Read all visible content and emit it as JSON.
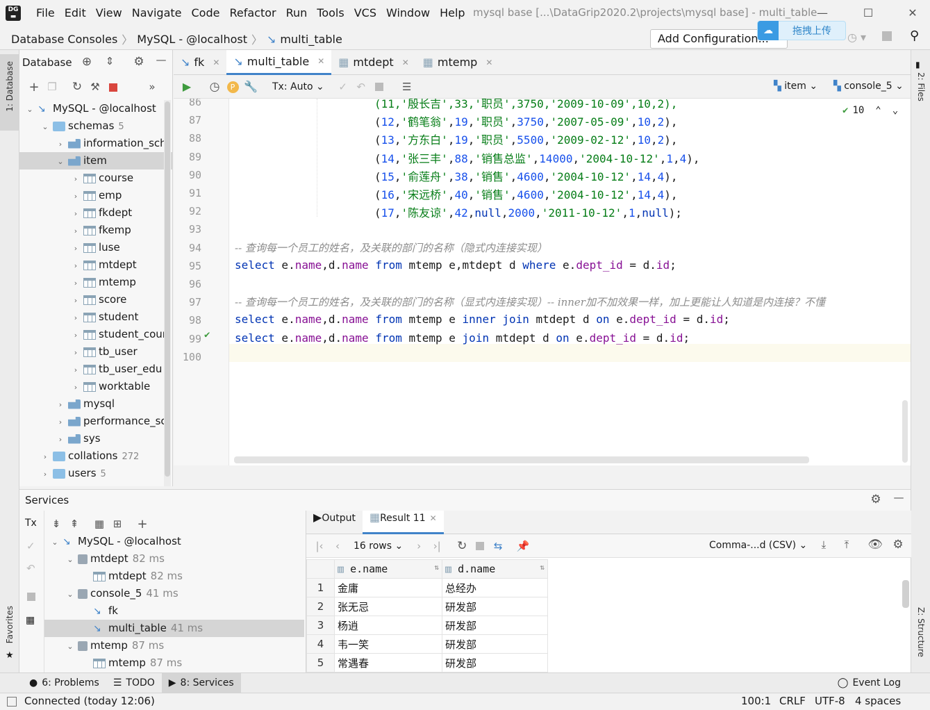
{
  "window": {
    "title": "mysql base [...\\DataGrip2020.2\\projects\\mysql base] - multi_table",
    "menu": [
      "File",
      "Edit",
      "View",
      "Navigate",
      "Code",
      "Refactor",
      "Run",
      "Tools",
      "VCS",
      "Window",
      "Help"
    ]
  },
  "breadcrumb": [
    "Database Consoles",
    "MySQL - @localhost",
    "multi_table"
  ],
  "toolbar": {
    "add_configuration": "Add Configuration...",
    "upload_label": "拖拽上传"
  },
  "stripes": {
    "database": "1: Database",
    "favorites": "Favorites",
    "files": "2: Files",
    "structure": "Z: Structure"
  },
  "db_panel": {
    "title": "Database",
    "tree": [
      {
        "label": "MySQL - @localhost",
        "icon": "mysql-connection-icon",
        "indent": 0,
        "open": true
      },
      {
        "label": "schemas",
        "count": "5",
        "icon": "folder-icon",
        "indent": 1,
        "open": true
      },
      {
        "label": "information_sch",
        "icon": "schema-icon",
        "indent": 2,
        "open": false
      },
      {
        "label": "item",
        "icon": "schema-icon",
        "indent": 2,
        "open": true,
        "selected": true
      },
      {
        "label": "course",
        "icon": "table-icon",
        "indent": 3
      },
      {
        "label": "emp",
        "icon": "table-icon",
        "indent": 3
      },
      {
        "label": "fkdept",
        "icon": "table-icon",
        "indent": 3
      },
      {
        "label": "fkemp",
        "icon": "table-icon",
        "indent": 3
      },
      {
        "label": "luse",
        "icon": "table-icon",
        "indent": 3
      },
      {
        "label": "mtdept",
        "icon": "table-icon",
        "indent": 3
      },
      {
        "label": "mtemp",
        "icon": "table-icon",
        "indent": 3
      },
      {
        "label": "score",
        "icon": "table-icon",
        "indent": 3
      },
      {
        "label": "student",
        "icon": "table-icon",
        "indent": 3
      },
      {
        "label": "student_cour",
        "icon": "table-icon",
        "indent": 3
      },
      {
        "label": "tb_user",
        "icon": "table-icon",
        "indent": 3
      },
      {
        "label": "tb_user_edu",
        "icon": "table-icon",
        "indent": 3
      },
      {
        "label": "worktable",
        "icon": "table-icon",
        "indent": 3
      },
      {
        "label": "mysql",
        "icon": "schema-icon",
        "indent": 2,
        "open": false
      },
      {
        "label": "performance_sc",
        "icon": "schema-icon",
        "indent": 2,
        "open": false
      },
      {
        "label": "sys",
        "icon": "schema-icon",
        "indent": 2,
        "open": false
      },
      {
        "label": "collations",
        "count": "272",
        "icon": "folder-icon",
        "indent": 1,
        "open": false
      },
      {
        "label": "users",
        "count": "5",
        "icon": "folder-icon",
        "indent": 1,
        "open": false
      }
    ]
  },
  "editor": {
    "tabs": [
      {
        "label": "fk",
        "icon": "console-icon",
        "active": false
      },
      {
        "label": "multi_table",
        "icon": "console-icon",
        "active": true
      },
      {
        "label": "mtdept",
        "icon": "table-icon",
        "active": false
      },
      {
        "label": "mtemp",
        "icon": "table-icon",
        "active": false
      }
    ],
    "tx_mode": "Tx: Auto",
    "schema_selector": "item",
    "console_selector": "console_5",
    "inspection_count": "10",
    "lines": [
      {
        "n": "86",
        "html": "<span class=\"str\">(11,'殷长吉',33,'职员',3750,'2009-10-09',10,2),</span>"
      },
      {
        "n": "87",
        "html": "(<span class=\"num\">12</span>,<span class=\"str\">'鹤笔翁'</span>,<span class=\"num\">19</span>,<span class=\"str\">'职员'</span>,<span class=\"num\">3750</span>,<span class=\"str\">'2007-05-09'</span>,<span class=\"num\">10</span>,<span class=\"num\">2</span>),"
      },
      {
        "n": "88",
        "html": "(<span class=\"num\">13</span>,<span class=\"str\">'方东白'</span>,<span class=\"num\">19</span>,<span class=\"str\">'职员'</span>,<span class=\"num\">5500</span>,<span class=\"str\">'2009-02-12'</span>,<span class=\"num\">10</span>,<span class=\"num\">2</span>),"
      },
      {
        "n": "89",
        "html": "(<span class=\"num\">14</span>,<span class=\"str\">'张三丰'</span>,<span class=\"num\">88</span>,<span class=\"str\">'销售总监'</span>,<span class=\"num\">14000</span>,<span class=\"str\">'2004-10-12'</span>,<span class=\"num\">1</span>,<span class=\"num\">4</span>),"
      },
      {
        "n": "90",
        "html": "(<span class=\"num\">15</span>,<span class=\"str\">'俞莲舟'</span>,<span class=\"num\">38</span>,<span class=\"str\">'销售'</span>,<span class=\"num\">4600</span>,<span class=\"str\">'2004-10-12'</span>,<span class=\"num\">14</span>,<span class=\"num\">4</span>),"
      },
      {
        "n": "91",
        "html": "(<span class=\"num\">16</span>,<span class=\"str\">'宋远桥'</span>,<span class=\"num\">40</span>,<span class=\"str\">'销售'</span>,<span class=\"num\">4600</span>,<span class=\"str\">'2004-10-12'</span>,<span class=\"num\">14</span>,<span class=\"num\">4</span>),"
      },
      {
        "n": "92",
        "html": "(<span class=\"num\">17</span>,<span class=\"str\">'陈友谅'</span>,<span class=\"num\">42</span>,<span class=\"kw\">null</span>,<span class=\"num\">2000</span>,<span class=\"str\">'2011-10-12'</span>,<span class=\"num\">1</span>,<span class=\"kw\">null</span>);"
      },
      {
        "n": "93",
        "html": ""
      },
      {
        "n": "94",
        "html": "<span class=\"cm\">-- 查询每一个员工的姓名，及关联的部门的名称（隐式内连接实现）</span>"
      },
      {
        "n": "95",
        "html": "<span class=\"kw\">select</span> e.<span class=\"fld\">name</span>,d.<span class=\"fld\">name</span> <span class=\"kw\">from</span> mtemp e,mtdept d <span class=\"kw\">where</span> e.<span class=\"fld\">dept_id</span> = d.<span class=\"fld\">id</span>;"
      },
      {
        "n": "96",
        "html": ""
      },
      {
        "n": "97",
        "html": "<span class=\"cm\">-- 查询每一个员工的姓名，及关联的部门的名称（显式内连接实现）-- inner加不加效果一样，加上更能让人知道是内连接？不懂</span>"
      },
      {
        "n": "98",
        "html": "<span class=\"kw\">select</span> e.<span class=\"fld\">name</span>,d.<span class=\"fld\">name</span> <span class=\"kw\">from</span> mtemp e <span class=\"kw\">inner join</span> mtdept d <span class=\"kw\">on</span> e.<span class=\"fld\">dept_id</span> = d.<span class=\"fld\">id</span>;"
      },
      {
        "n": "99",
        "html": "<span class=\"kw\">select</span> e.<span class=\"fld\">name</span>,d.<span class=\"fld\">name</span> <span class=\"kw\">from</span> mtemp e <span class=\"kw\">join</span> mtdept d <span class=\"kw\">on</span> e.<span class=\"fld\">dept_id</span> = d.<span class=\"fld\">id</span>;"
      },
      {
        "n": "100",
        "html": ""
      }
    ]
  },
  "services": {
    "title": "Services",
    "tree": [
      {
        "label": "MySQL - @localhost",
        "ms": "",
        "indent": 0,
        "icon": "mysql-connection-icon"
      },
      {
        "label": "mtdept",
        "ms": "82 ms",
        "indent": 1,
        "icon": "session-icon"
      },
      {
        "label": "mtdept",
        "ms": "82 ms",
        "indent": 2,
        "icon": "table-icon"
      },
      {
        "label": "console_5",
        "ms": "41 ms",
        "indent": 1,
        "icon": "session-icon"
      },
      {
        "label": "fk",
        "ms": "",
        "indent": 2,
        "icon": "console-icon"
      },
      {
        "label": "multi_table",
        "ms": "41 ms",
        "indent": 2,
        "icon": "console-icon",
        "selected": true
      },
      {
        "label": "mtemp",
        "ms": "87 ms",
        "indent": 1,
        "icon": "session-icon"
      },
      {
        "label": "mtemp",
        "ms": "87 ms",
        "indent": 2,
        "icon": "table-icon"
      }
    ],
    "tabs": {
      "output": "Output",
      "result": "Result 11"
    },
    "rows_label": "16 rows",
    "export_format": "Comma-...d (CSV)",
    "columns": [
      "e.name",
      "d.name"
    ],
    "rows": [
      [
        "1",
        "金庸",
        "总经办"
      ],
      [
        "2",
        "张无忌",
        "研发部"
      ],
      [
        "3",
        "杨逍",
        "研发部"
      ],
      [
        "4",
        "韦一笑",
        "研发部"
      ],
      [
        "5",
        "常遇春",
        "研发部"
      ]
    ]
  },
  "tool_windows": [
    {
      "label": "6: Problems",
      "icon": "problems-icon"
    },
    {
      "label": "TODO",
      "icon": "todo-icon"
    },
    {
      "label": "8: Services",
      "icon": "services-icon",
      "active": true
    }
  ],
  "event_log": "Event Log",
  "status": {
    "message": "Connected (today 12:06)",
    "position": "100:1",
    "line_sep": "CRLF",
    "encoding": "UTF-8",
    "indent": "4 spaces"
  }
}
